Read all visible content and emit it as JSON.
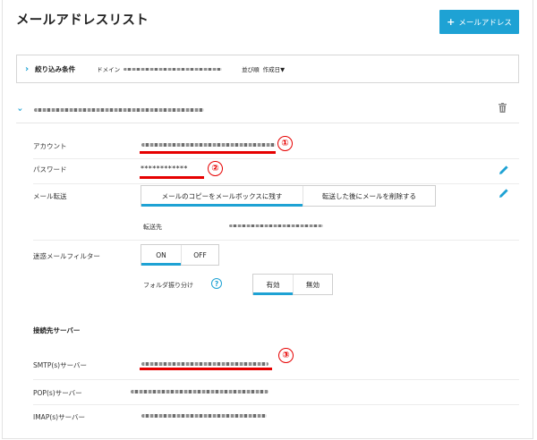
{
  "page": {
    "title": "メールアドレスリスト",
    "add_button_label": "メールアドレス",
    "add_button_icon": "plus-icon"
  },
  "filter": {
    "title": "絞り込み条件",
    "domain_label": "ドメイン",
    "sort_label": "並び順",
    "sort_value": "作成日▼"
  },
  "account": {
    "fields": {
      "account_label": "アカウント",
      "password_label": "パスワード",
      "password_value": "************",
      "forward_label": "メール転送",
      "forward_options": [
        "メールのコピーをメールボックスに残す",
        "転送した後にメールを削除する"
      ],
      "forward_to_label": "転送先",
      "spam_label": "迷惑メールフィルター",
      "spam_options": [
        "ON",
        "OFF"
      ],
      "folder_label": "フォルダ振り分け",
      "folder_options": [
        "有効",
        "無効"
      ]
    },
    "server_section": {
      "title": "接続先サーバー",
      "smtp_label": "SMTP(s)サーバー",
      "pop_label": "POP(s)サーバー",
      "imap_label": "IMAP(s)サーバー"
    }
  },
  "annotations": {
    "marker_1": "①",
    "marker_2": "②",
    "marker_3": "③",
    "marker_color": "#e60000"
  },
  "colors": {
    "accent": "#1ea2d4"
  }
}
